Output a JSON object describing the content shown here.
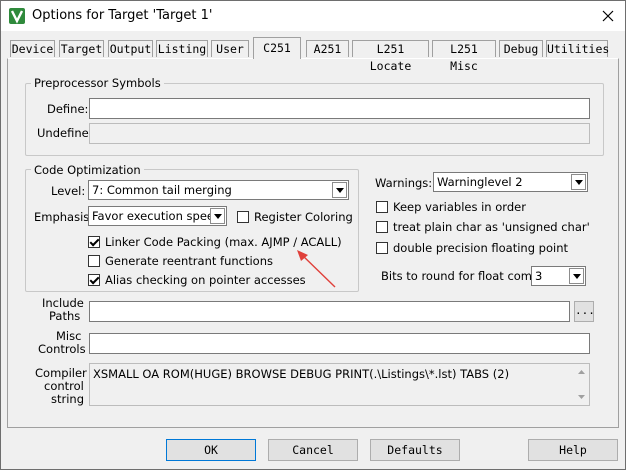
{
  "window": {
    "title": "Options for Target 'Target 1'"
  },
  "tabs": [
    {
      "label": "Device"
    },
    {
      "label": "Target"
    },
    {
      "label": "Output"
    },
    {
      "label": "Listing"
    },
    {
      "label": "User"
    },
    {
      "label": "C251"
    },
    {
      "label": "A251"
    },
    {
      "label": "L251 Locate"
    },
    {
      "label": "L251 Misc"
    },
    {
      "label": "Debug"
    },
    {
      "label": "Utilities"
    }
  ],
  "active_tab": "C251",
  "preprocessor": {
    "group_label": "Preprocessor Symbols",
    "define_label": "Define:",
    "define_value": "",
    "undefine_label": "Undefine:",
    "undefine_value": ""
  },
  "code_optimization": {
    "group_label": "Code Optimization",
    "level_label": "Level:",
    "level_value": "7: Common tail merging",
    "emphasis_label": "Emphasis:",
    "emphasis_value": "Favor execution speed",
    "register_coloring": {
      "label": "Register Coloring",
      "checked": false
    },
    "linker_code_packing": {
      "label": "Linker Code Packing (max. AJMP / ACALL)",
      "checked": true
    },
    "reentrant": {
      "label": "Generate reentrant functions",
      "checked": false
    },
    "alias_checking": {
      "label": "Alias checking on pointer accesses",
      "checked": true
    }
  },
  "warnings": {
    "label": "Warnings:",
    "value": "Warninglevel 2",
    "keep_variables": {
      "label": "Keep variables in order",
      "checked": false
    },
    "plain_char": {
      "label": "treat plain char as 'unsigned char'",
      "checked": false
    },
    "double_precision": {
      "label": "double precision floating point",
      "checked": false
    },
    "bits_round_label": "Bits to round for float compare:",
    "bits_round_value": "3"
  },
  "paths": {
    "include_label_1": "Include",
    "include_label_2": "Paths",
    "include_value": "",
    "browse_label": "...",
    "misc_label_1": "Misc",
    "misc_label_2": "Controls",
    "misc_value": "",
    "compiler_label_1": "Compiler",
    "compiler_label_2": "control",
    "compiler_label_3": "string",
    "compiler_value": "XSMALL OA ROM(HUGE) BROWSE DEBUG PRINT(.\\Listings\\*.lst) TABS (2)"
  },
  "buttons": {
    "ok": "OK",
    "cancel": "Cancel",
    "defaults": "Defaults",
    "help": "Help"
  },
  "colors": {
    "annotation_arrow": "#e0403a",
    "default_button_border": "#0078d7"
  }
}
